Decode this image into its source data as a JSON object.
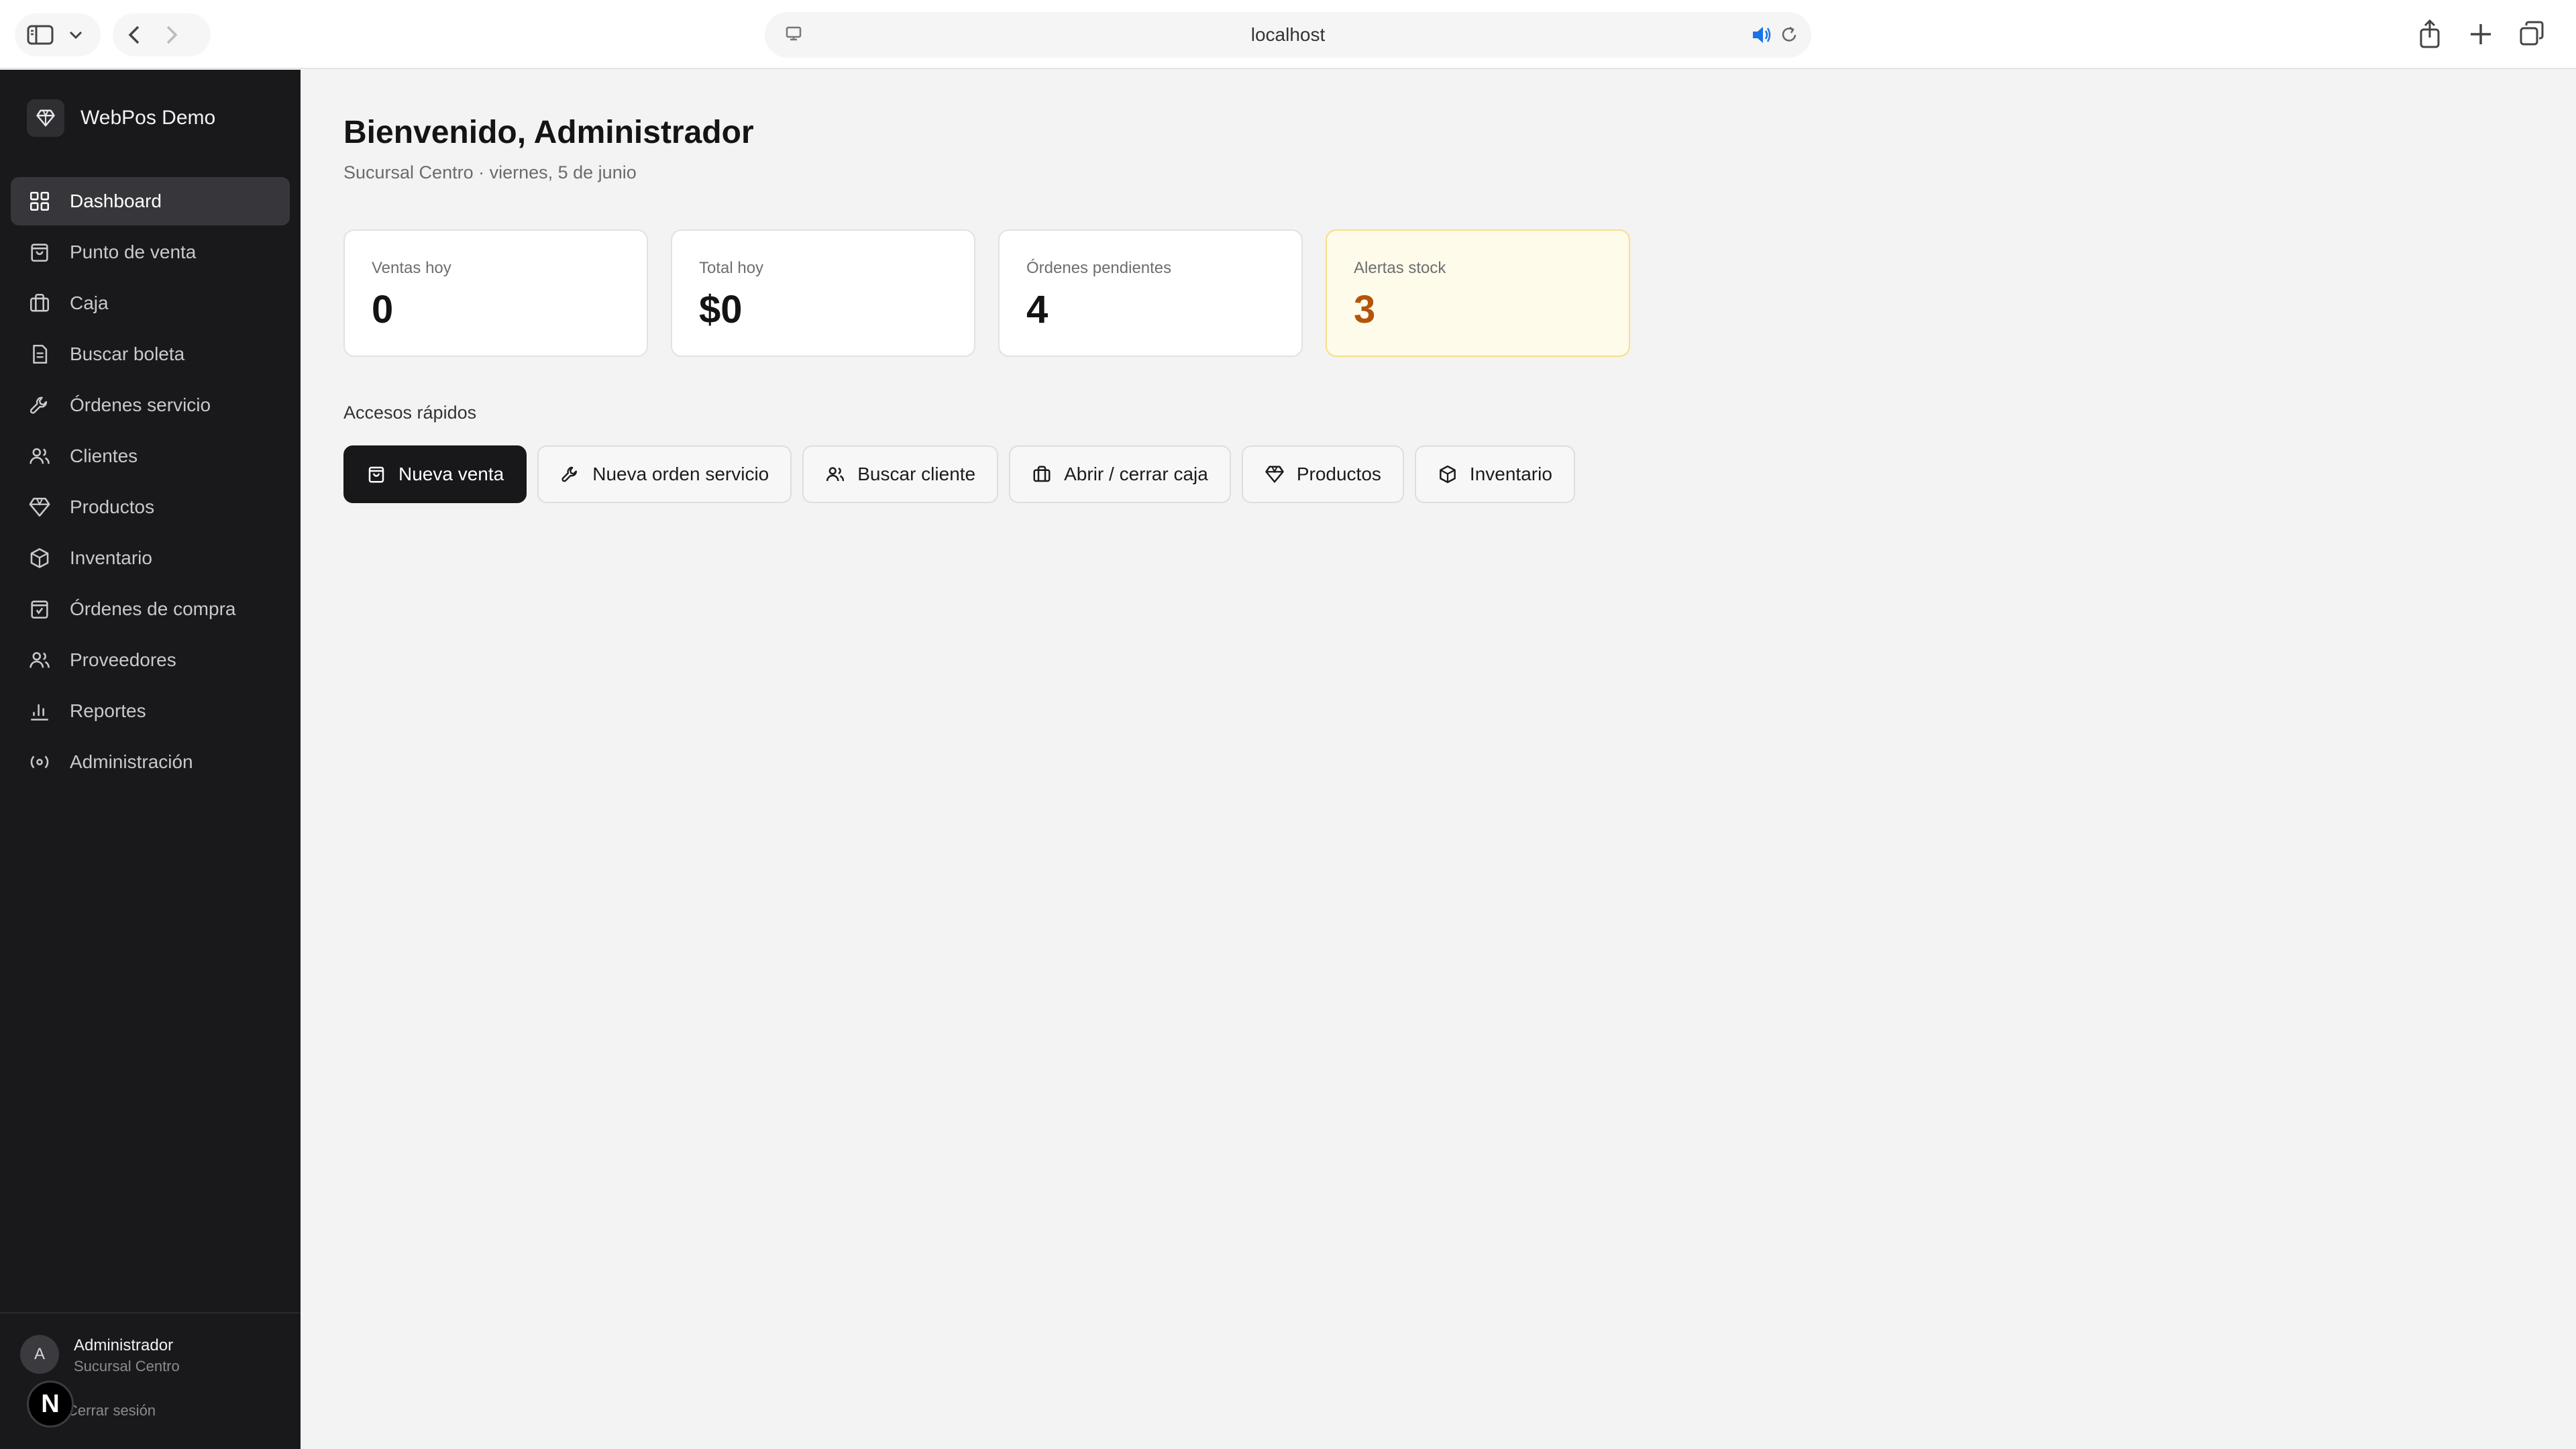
{
  "browser": {
    "url": "localhost"
  },
  "sidebar": {
    "brand": "WebPos Demo",
    "items": [
      {
        "label": "Dashboard",
        "icon": "dashboard-icon",
        "active": true
      },
      {
        "label": "Punto de venta",
        "icon": "shopping-bag-icon"
      },
      {
        "label": "Caja",
        "icon": "briefcase-icon"
      },
      {
        "label": "Buscar boleta",
        "icon": "receipt-icon"
      },
      {
        "label": "Órdenes servicio",
        "icon": "wrench-icon"
      },
      {
        "label": "Clientes",
        "icon": "users-icon"
      },
      {
        "label": "Productos",
        "icon": "gem-icon"
      },
      {
        "label": "Inventario",
        "icon": "box-icon"
      },
      {
        "label": "Órdenes de compra",
        "icon": "purchase-order-icon"
      },
      {
        "label": "Proveedores",
        "icon": "suppliers-icon"
      },
      {
        "label": "Reportes",
        "icon": "bar-chart-icon"
      },
      {
        "label": "Administración",
        "icon": "admin-icon"
      }
    ],
    "user": {
      "initial": "A",
      "name": "Administrador",
      "branch": "Sucursal Centro",
      "logout": "Cerrar sesión"
    }
  },
  "main": {
    "title": "Bienvenido, Administrador",
    "subtitle": "Sucursal Centro · viernes, 5 de junio",
    "cards": [
      {
        "label": "Ventas hoy",
        "value": "0"
      },
      {
        "label": "Total hoy",
        "value": "$0"
      },
      {
        "label": "Órdenes pendientes",
        "value": "4"
      },
      {
        "label": "Alertas stock",
        "value": "3"
      }
    ],
    "quick_title": "Accesos rápidos",
    "quick_actions": [
      {
        "label": "Nueva venta",
        "icon": "shopping-bag-icon"
      },
      {
        "label": "Nueva orden servicio",
        "icon": "wrench-icon"
      },
      {
        "label": "Buscar cliente",
        "icon": "users-icon"
      },
      {
        "label": "Abrir / cerrar caja",
        "icon": "briefcase-icon"
      },
      {
        "label": "Productos",
        "icon": "gem-icon"
      },
      {
        "label": "Inventario",
        "icon": "box-icon"
      }
    ]
  },
  "colors": {
    "sidebar_bg": "#19191b",
    "alert_card_bg": "#fffbeb",
    "alert_value": "#b45309",
    "primary_button": "#18181b"
  }
}
